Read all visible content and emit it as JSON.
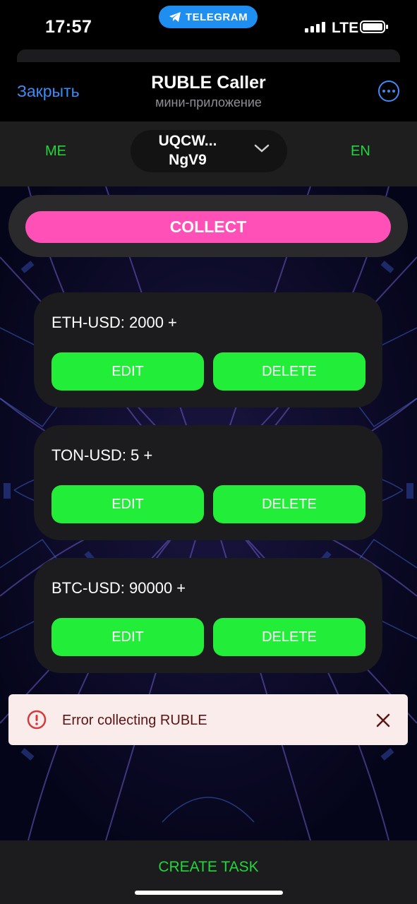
{
  "status_bar": {
    "time": "17:57",
    "pill_label": "TELEGRAM",
    "network": "LTE"
  },
  "telegram_header": {
    "close_label": "Закрыть",
    "title": "RUBLE Caller",
    "subtitle": "мини-приложение"
  },
  "app_bar": {
    "lang_left": "ME",
    "lang_right": "EN",
    "wallet_line1": "UQCW...",
    "wallet_line2": "NgV9"
  },
  "collect_label": "COLLECT",
  "tasks": [
    {
      "label": "ETH-USD: 2000 +",
      "edit_label": "EDIT",
      "delete_label": "DELETE"
    },
    {
      "label": "TON-USD: 5 +",
      "edit_label": "EDIT",
      "delete_label": "DELETE"
    },
    {
      "label": "BTC-USD: 90000 +",
      "edit_label": "EDIT",
      "delete_label": "DELETE"
    }
  ],
  "toast": {
    "message": "Error collecting RUBLE"
  },
  "create_task_label": "CREATE TASK",
  "colors": {
    "accent_green": "#22ee3a",
    "collect_pink": "#ff50b8",
    "link_blue": "#3d8bf5",
    "toast_bg": "#fbecec",
    "error_red": "#d33a3a"
  }
}
